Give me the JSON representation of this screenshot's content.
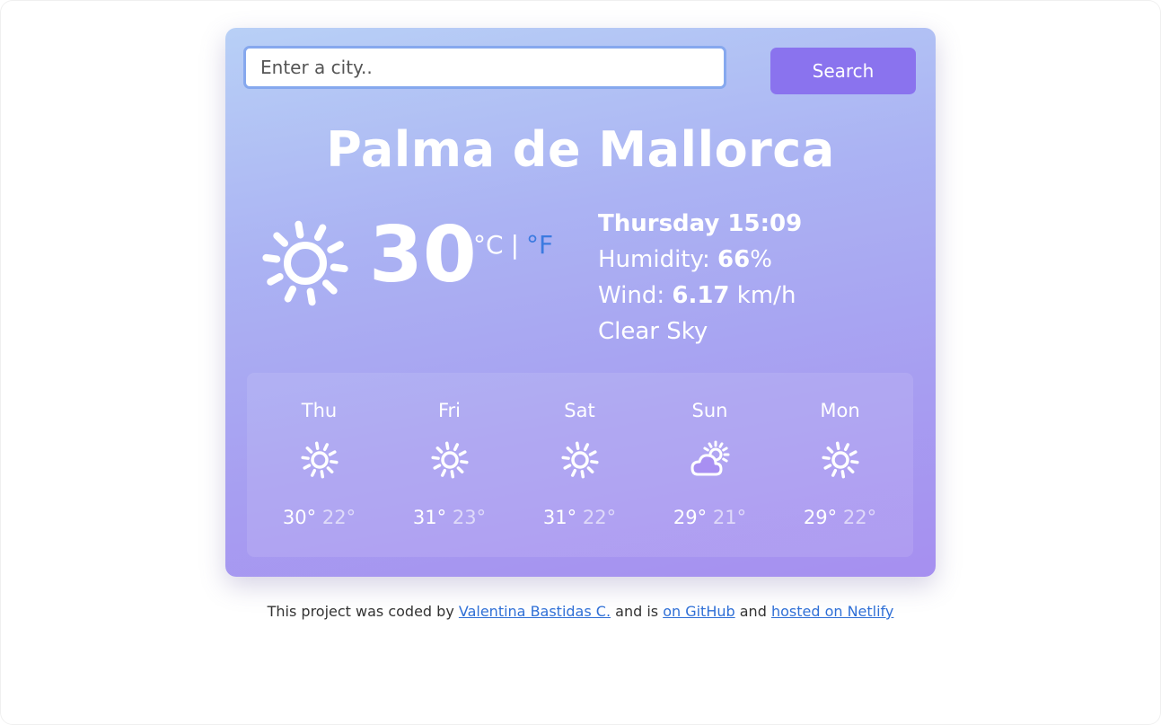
{
  "search": {
    "placeholder": "Enter a city..",
    "value": "",
    "button_label": "Search"
  },
  "current": {
    "city": "Palma de Mallorca",
    "temperature": "30",
    "unit_c": "°C",
    "unit_sep": "|",
    "unit_f": "°F",
    "datetime": "Thursday 15:09",
    "humidity_label": "Humidity: ",
    "humidity_value": "66",
    "humidity_unit": "%",
    "wind_label": "Wind: ",
    "wind_value": "6.17",
    "wind_unit": " km/h",
    "description": "Clear Sky",
    "icon": "sun-icon"
  },
  "forecast": [
    {
      "day": "Thu",
      "high": "30°",
      "low": "22°",
      "icon": "sun-icon"
    },
    {
      "day": "Fri",
      "high": "31°",
      "low": "23°",
      "icon": "sun-icon"
    },
    {
      "day": "Sat",
      "high": "31°",
      "low": "22°",
      "icon": "sun-icon"
    },
    {
      "day": "Sun",
      "high": "29°",
      "low": "21°",
      "icon": "partly-cloudy-icon"
    },
    {
      "day": "Mon",
      "high": "29°",
      "low": "22°",
      "icon": "sun-icon"
    }
  ],
  "footer": {
    "prefix": "This project was coded by ",
    "author_link": "Valentina Bastidas C.",
    "middle": " and is ",
    "github_link": "on GitHub",
    "and": " and ",
    "netlify_link": "hosted on Netlify"
  },
  "colors": {
    "accent": "#8a73ee",
    "link": "#2f6fd6",
    "fahrenheit": "#3b7ae0"
  }
}
